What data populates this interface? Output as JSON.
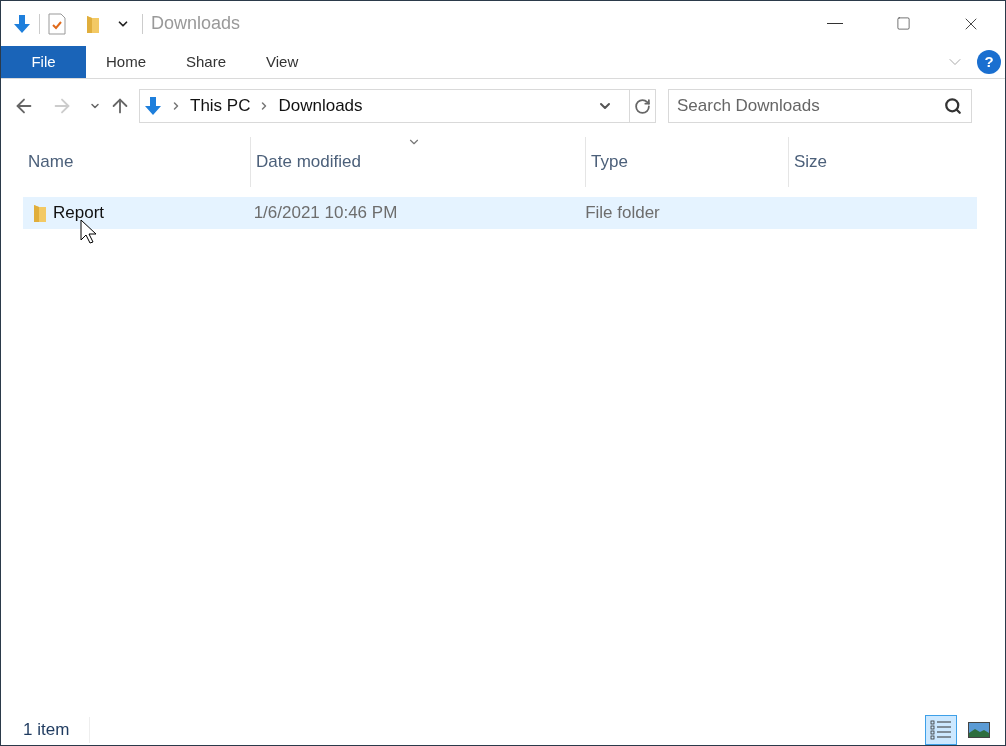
{
  "window": {
    "title": "Downloads"
  },
  "ribbon": {
    "tabs": [
      {
        "label": "File",
        "selected": true
      },
      {
        "label": "Home",
        "selected": false
      },
      {
        "label": "Share",
        "selected": false
      },
      {
        "label": "View",
        "selected": false
      }
    ],
    "help": "?"
  },
  "address": {
    "crumbs": [
      "This PC",
      "Downloads"
    ]
  },
  "search": {
    "placeholder": "Search Downloads"
  },
  "table": {
    "columns": [
      "Name",
      "Date modified",
      "Type",
      "Size"
    ],
    "rows": [
      {
        "name": "Report",
        "date_modified": "1/6/2021 10:46 PM",
        "type": "File folder",
        "size": "",
        "selected": true
      }
    ]
  },
  "status_bar": {
    "count": "1 item",
    "views": [
      {
        "kind": "details",
        "selected": true
      },
      {
        "kind": "large_icons",
        "selected": false
      }
    ]
  }
}
